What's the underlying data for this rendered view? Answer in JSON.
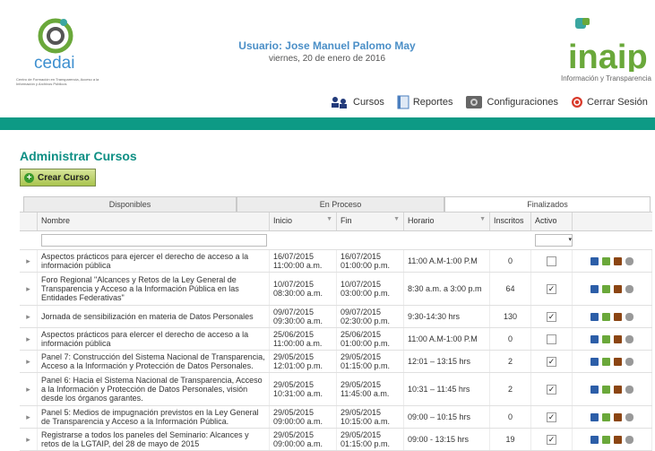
{
  "header": {
    "user_label": "Usuario: Jose Manuel Palomo May",
    "date": "viernes, 20 de enero de 2016",
    "cedai_text": "cedai",
    "cedai_sub": "Centro de Formación en Transparencia, Acceso a la Información y Archivos Públicos",
    "inaip_text": "inaip",
    "inaip_sub": "Información y Transparencia"
  },
  "nav": {
    "cursos": "Cursos",
    "reportes": "Reportes",
    "configuraciones": "Configuraciones",
    "cerrar": "Cerrar Sesión"
  },
  "page": {
    "title": "Administrar Cursos",
    "create_label": "Crear Curso"
  },
  "tabs": [
    "Disponibles",
    "En Proceso",
    "Finalizados"
  ],
  "columns": [
    "Nombre",
    "Inicio",
    "Fin",
    "Horario",
    "Inscritos",
    "Activo"
  ],
  "rows": [
    {
      "nombre": "Aspectos prácticos para ejercer el derecho de acceso a la información pública",
      "inicio": "16/07/2015 11:00:00 a.m.",
      "fin": "16/07/2015 01:00:00 p.m.",
      "horario": "11:00 A.M-1:00 P.M",
      "inscritos": "0",
      "activo": false
    },
    {
      "nombre": "Foro Regional \"Alcances y Retos de la Ley General de Transparencia y Acceso a la Información Pública en las Entidades Federativas\"",
      "inicio": "10/07/2015 08:30:00 a.m.",
      "fin": "10/07/2015 03:00:00 p.m.",
      "horario": "8:30 a.m. a 3:00 p.m",
      "inscritos": "64",
      "activo": true
    },
    {
      "nombre": "Jornada de sensibilización en materia de Datos Personales",
      "inicio": "09/07/2015 09:30:00 a.m.",
      "fin": "09/07/2015 02:30:00 p.m.",
      "horario": "9:30-14:30 hrs",
      "inscritos": "130",
      "activo": true
    },
    {
      "nombre": "Aspectos prácticos para elercer el derecho de acceso a la información pública",
      "inicio": "25/06/2015 11:00:00 a.m.",
      "fin": "25/06/2015 01:00:00 p.m.",
      "horario": "11:00 A.M-1:00 P.M",
      "inscritos": "0",
      "activo": false
    },
    {
      "nombre": "Panel 7: Construcción del Sistema Nacional de Transparencia, Acceso a la Información y Protección de Datos Personales.",
      "inicio": "29/05/2015 12:01:00 p.m.",
      "fin": "29/05/2015 01:15:00 p.m.",
      "horario": "12:01 – 13:15 hrs",
      "inscritos": "2",
      "activo": true
    },
    {
      "nombre": "Panel 6: Hacia el Sistema Nacional de Transparencia, Acceso a la Información y Protección de Datos Personales, visión desde los órganos garantes.",
      "inicio": "29/05/2015 10:31:00 a.m.",
      "fin": "29/05/2015 11:45:00 a.m.",
      "horario": "10:31 – 11:45 hrs",
      "inscritos": "2",
      "activo": true
    },
    {
      "nombre": "Panel 5: Medios de impugnación previstos en la Ley General de Transparencia y Acceso a la Información Pública.",
      "inicio": "29/05/2015 09:00:00 a.m.",
      "fin": "29/05/2015 10:15:00 a.m.",
      "horario": "09:00 – 10:15 hrs",
      "inscritos": "0",
      "activo": true
    },
    {
      "nombre": "Registrarse a todos los paneles del Seminario: Alcances y retos de la LGTAIP, del 28 de mayo de 2015",
      "inicio": "29/05/2015 09:00:00 a.m.",
      "fin": "29/05/2015 01:15:00 p.m.",
      "horario": "09:00 - 13:15 hrs",
      "inscritos": "19",
      "activo": true
    }
  ]
}
